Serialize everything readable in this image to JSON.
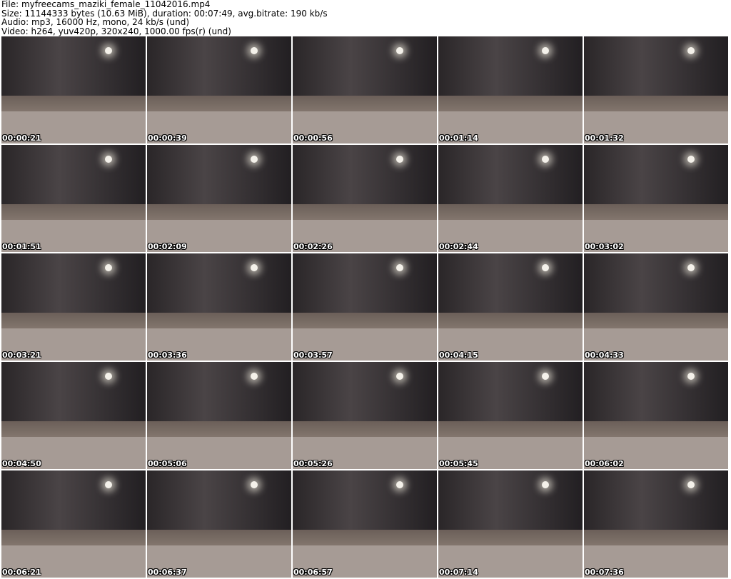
{
  "header": {
    "file": "File: myfreecams_maziki_female_11042016.mp4",
    "size": "Size: 11144333 bytes (10.63 MiB), duration: 00:07:49, avg.bitrate: 190 kb/s",
    "audio": "Audio: mp3, 16000 Hz, mono, 24 kb/s (und)",
    "video": "Video: h264, yuv420p, 320x240, 1000.00 fps(r) (und)"
  },
  "thumbnails": [
    "00:00:21",
    "00:00:39",
    "00:00:56",
    "00:01:14",
    "00:01:32",
    "00:01:51",
    "00:02:09",
    "00:02:26",
    "00:02:44",
    "00:03:02",
    "00:03:21",
    "00:03:36",
    "00:03:57",
    "00:04:15",
    "00:04:33",
    "00:04:50",
    "00:05:06",
    "00:05:26",
    "00:05:45",
    "00:06:02",
    "00:06:21",
    "00:06:37",
    "00:06:57",
    "00:07:14",
    "00:07:36"
  ]
}
